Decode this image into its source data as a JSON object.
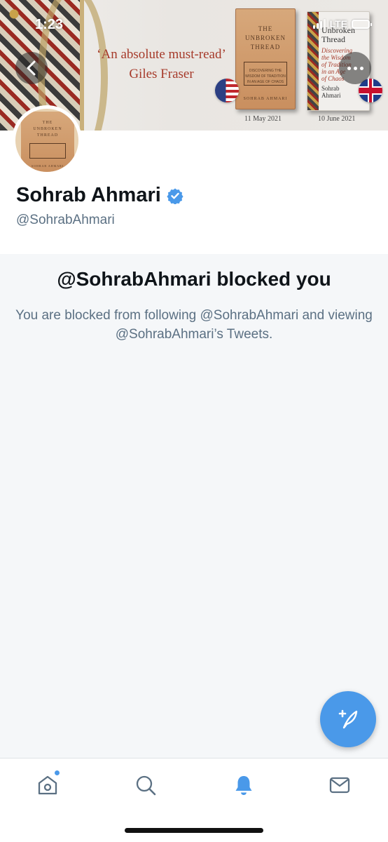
{
  "status_bar": {
    "time": "1:23",
    "network": "LTE"
  },
  "banner": {
    "quote_line1": "‘An absolute must-read’",
    "quote_line2": "Giles Fraser",
    "book_us": {
      "title_line1": "THE",
      "title_line2": "UNBROKEN",
      "title_line3": "THREAD",
      "subtitle_line1": "DISCOVERING THE",
      "subtitle_line2": "WISDOM OF TRADITION",
      "subtitle_line3": "IN AN AGE OF CHAOS",
      "author": "SOHRAB AHMARI",
      "date": "11 May 2021"
    },
    "book_uk": {
      "title_line1": "Unbroken",
      "title_line2": "Thread",
      "subtitle_line1": "Discovering",
      "subtitle_line2": "the Wisdom",
      "subtitle_line3": "of Tradition",
      "subtitle_line4": "in an Age",
      "subtitle_line5": "of Chaos",
      "author_line1": "Sohrab",
      "author_line2": "Ahmari",
      "date": "10 June 2021"
    }
  },
  "profile": {
    "display_name": "Sohrab Ahmari",
    "handle": "@SohrabAhmari",
    "verified": true
  },
  "blocked": {
    "title": "@SohrabAhmari blocked you",
    "description": "You are blocked from following @SohrabAhmari and viewing @SohrabAhmari’s Tweets."
  },
  "tabs": [
    {
      "name": "home",
      "icon": "home-icon",
      "has_badge": true
    },
    {
      "name": "search",
      "icon": "search-icon"
    },
    {
      "name": "notifications",
      "icon": "bell-icon",
      "active": true
    },
    {
      "name": "messages",
      "icon": "mail-icon"
    }
  ],
  "colors": {
    "accent": "#4a99e9",
    "muted_text": "#5b7083",
    "panel_bg": "#f5f7f9"
  }
}
